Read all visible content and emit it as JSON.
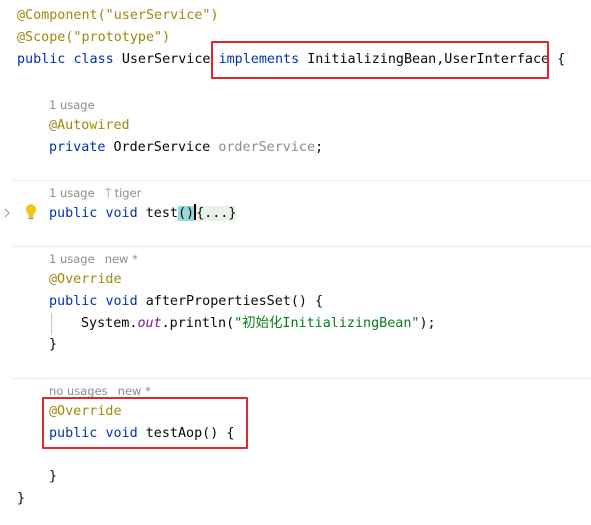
{
  "header": {
    "line1": "@Component(\"userService\")",
    "line2": "@Scope(\"prototype\")",
    "class_decl": {
      "public": "public",
      "class": "class",
      "name": "UserService",
      "implements": "implements",
      "interfaces": "InitializingBean,UserInterface",
      "brace": "{"
    }
  },
  "field_block": {
    "hint_usage": "1 usage",
    "annotation": "@Autowired",
    "private": "private",
    "type": "OrderService",
    "name": "orderService",
    "semicolon": ";"
  },
  "test_method": {
    "hint_usage": "1 usage",
    "hint_author": "tiger",
    "public": "public",
    "void": "void",
    "name": "test",
    "parens": "()",
    "folded": "{...}"
  },
  "after_props": {
    "hint_usage": "1 usage",
    "hint_new": "new *",
    "annotation": "@Override",
    "public": "public",
    "void": "void",
    "signature": "afterPropertiesSet() {",
    "body_prefix": "System.",
    "body_out": "out",
    "body_call": ".println(",
    "body_string": "\"初始化InitializingBean\"",
    "body_suffix": ");",
    "close": "}"
  },
  "test_aop": {
    "hint_usage": "no usages",
    "hint_new": "new *",
    "annotation": "@Override",
    "public": "public",
    "void": "void",
    "signature": "testAop() {",
    "close": "}"
  },
  "class_close": "}",
  "colors": {
    "keyword": "#0033b3",
    "annotation": "#9e880d",
    "string": "#067d17",
    "field": "#871094",
    "highlight_box": "#e0282e"
  },
  "icons": [
    "lightbulb-icon",
    "fold-arrow-icon",
    "author-icon"
  ]
}
